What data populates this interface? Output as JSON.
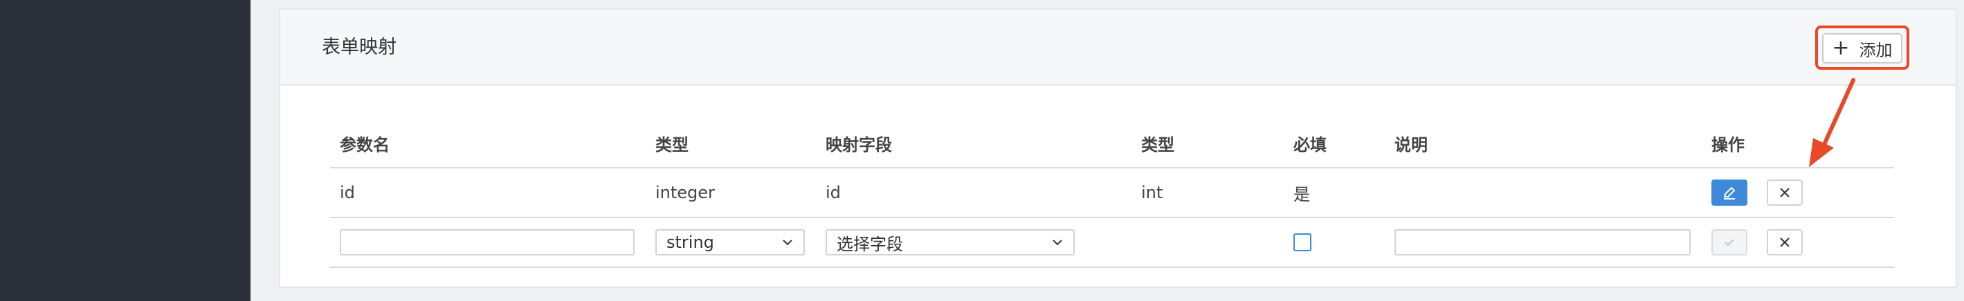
{
  "section": {
    "title": "表单映射",
    "add_button_label": "添加",
    "add_button_icon": "plus-icon"
  },
  "table": {
    "headers": [
      "参数名",
      "类型",
      "映射字段",
      "类型",
      "必填",
      "说明",
      "操作"
    ],
    "row": {
      "param_name": "id",
      "type": "integer",
      "mapped_field": "id",
      "mapped_type": "int",
      "required": "是",
      "description": ""
    },
    "edit_row": {
      "param_name_value": "",
      "type_selected": "string",
      "mapped_field_selected": "选择字段",
      "required_checked": false,
      "description_value": ""
    }
  },
  "colors": {
    "sidebar": "#2b303b",
    "primary": "#3d8bd8",
    "annotation": "#e64a26"
  }
}
